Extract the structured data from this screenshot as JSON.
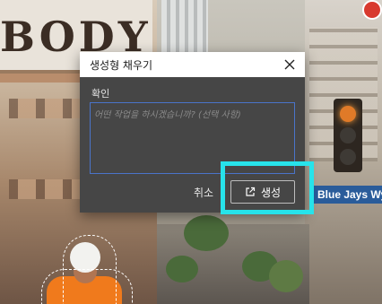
{
  "background": {
    "sign_text": "BODY",
    "street_sign_text": "Blue Jays Wy"
  },
  "dialog": {
    "title": "생성형 채우기",
    "close_icon": "close-icon",
    "field_label": "확인",
    "prompt_placeholder": "어떤 작업을 하시겠습니까? (선택 사항)",
    "prompt_value": "",
    "cancel_label": "취소",
    "generate_label": "생성",
    "generate_icon": "external-generate-icon"
  },
  "colors": {
    "dialog_bg": "#464646",
    "input_border": "#4a74c9",
    "highlight": "#27e3ea"
  }
}
